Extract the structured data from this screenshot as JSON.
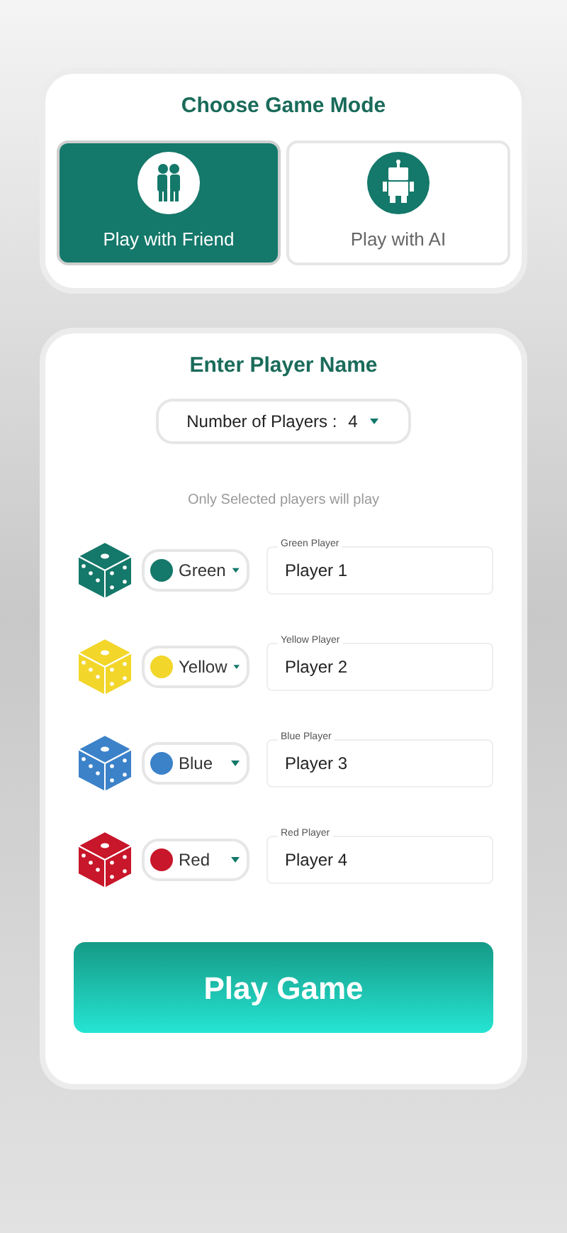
{
  "mode_card": {
    "title": "Choose Game Mode",
    "modes": [
      {
        "kind": "friends",
        "label": "Play with Friend",
        "selected": true
      },
      {
        "kind": "ai",
        "label": "Play with AI",
        "selected": false
      }
    ]
  },
  "players_card": {
    "title": "Enter Player Name",
    "count_select": {
      "label": "Number of Players :",
      "value": "4"
    },
    "hint": "Only Selected players will play",
    "players": [
      {
        "color": "#14786a",
        "color_name": "Green",
        "field_label": "Green Player",
        "value": "Player 1"
      },
      {
        "color": "#f2d62a",
        "color_name": "Yellow",
        "field_label": "Yellow Player",
        "value": "Player 2"
      },
      {
        "color": "#3b82c9",
        "color_name": "Blue",
        "field_label": "Blue Player",
        "value": "Player 3"
      },
      {
        "color": "#c8162a",
        "color_name": "Red",
        "field_label": "Red Player",
        "value": "Player 4"
      }
    ],
    "play_button": "Play Game"
  }
}
